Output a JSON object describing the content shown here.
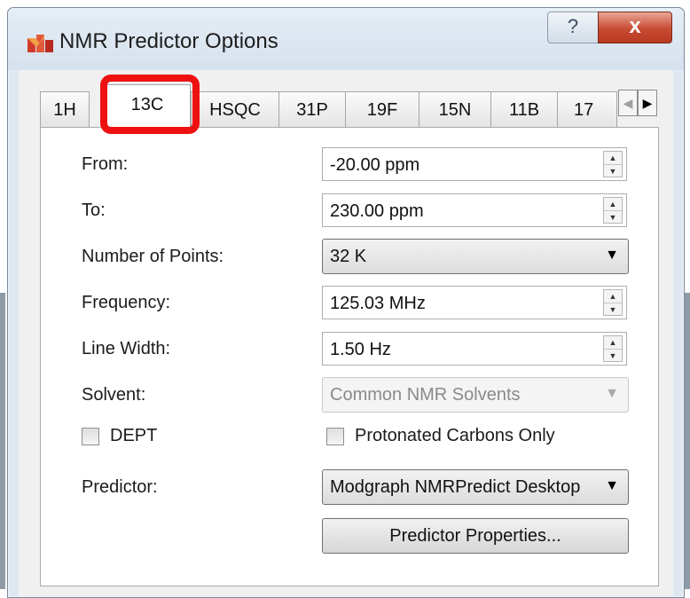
{
  "window": {
    "title": "NMR Predictor Options",
    "help_label": "?",
    "close_label": "x"
  },
  "tabs": [
    {
      "label": "1H"
    },
    {
      "label": "13C",
      "selected": true
    },
    {
      "label": "HSQC"
    },
    {
      "label": "31P"
    },
    {
      "label": "19F"
    },
    {
      "label": "15N"
    },
    {
      "label": "11B"
    },
    {
      "label": "17"
    }
  ],
  "tab_scroll": {
    "left": "◀",
    "right": "▶"
  },
  "form": {
    "from": {
      "label": "From:",
      "value": "-20.00 ppm"
    },
    "to": {
      "label": "To:",
      "value": "230.00 ppm"
    },
    "points": {
      "label": "Number of Points:",
      "value": "32 K"
    },
    "frequency": {
      "label": "Frequency:",
      "value": "125.03 MHz"
    },
    "line_width": {
      "label": "Line Width:",
      "value": "1.50 Hz"
    },
    "solvent": {
      "label": "Solvent:",
      "value": "Common NMR Solvents",
      "enabled": false
    },
    "dept": {
      "label": "DEPT",
      "checked": false
    },
    "protonated": {
      "label": "Protonated Carbons Only",
      "checked": false
    },
    "predictor": {
      "label": "Predictor:",
      "value": "Modgraph NMRPredict Desktop"
    },
    "properties_button": "Predictor Properties..."
  },
  "colors": {
    "highlight": "#ee1111",
    "close_button": "#c84a33"
  },
  "icons": {
    "app": "mestrenova-app-icon",
    "spin_up": "▲",
    "spin_down": "▼",
    "caret": "▼"
  }
}
